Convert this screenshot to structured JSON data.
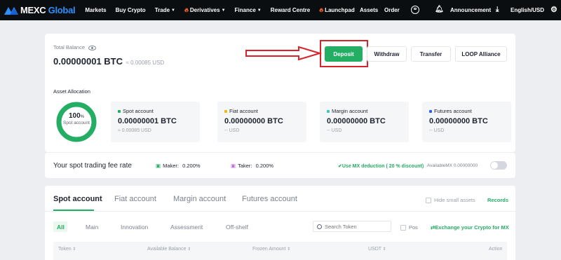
{
  "nav": {
    "logo_main": "MEXC",
    "logo_accent": "Global",
    "items": [
      {
        "label": "Markets",
        "chevron": false,
        "flame": false
      },
      {
        "label": "Buy Crypto",
        "chevron": false,
        "flame": false
      },
      {
        "label": "Trade",
        "chevron": true,
        "flame": false
      },
      {
        "label": "Derivatives",
        "chevron": true,
        "flame": true
      },
      {
        "label": "Finance",
        "chevron": true,
        "flame": false
      },
      {
        "label": "Reward Centre",
        "chevron": false,
        "flame": false
      },
      {
        "label": "Launchpad",
        "chevron": false,
        "flame": true
      }
    ],
    "right": {
      "assets": "Assets",
      "order": "Order",
      "announcement": "Announcement",
      "language": "English/USD"
    }
  },
  "balance": {
    "label": "Total Balance",
    "btc": "0.00000001 BTC",
    "usd": "≈ 0.00085 USD"
  },
  "actions": {
    "deposit": "Deposit",
    "withdraw": "Withdraw",
    "transfer": "Transfer",
    "loop": "LOOP Alliance"
  },
  "allocation": {
    "label": "Asset Allocation",
    "percent": "100",
    "percent_sign": "%",
    "ring_label": "Spot account",
    "ring_fill": 1.0,
    "accounts": [
      {
        "name": "Spot account",
        "amount": "0.00000001 BTC",
        "usd": "≈ 0.00085 USD",
        "color": "#24ae64"
      },
      {
        "name": "Fiat account",
        "amount": "0.00000000 BTC",
        "usd": "-- USD",
        "color": "#f0b90b"
      },
      {
        "name": "Margin account",
        "amount": "0.00000000 BTC",
        "usd": "-- USD",
        "color": "#3ec5c0"
      },
      {
        "name": "Futures account",
        "amount": "0.00000000 BTC",
        "usd": "-- USD",
        "color": "#2e5bff"
      }
    ]
  },
  "fees": {
    "title": "Your spot trading fee rate",
    "maker_label": "Maker:",
    "maker_value": "0.200%",
    "taker_label": "Taker:",
    "taker_value": "0.200%",
    "mx_deduction": "Use MX deduction ( 20 % discount)",
    "available": "AvailableMX 0.00000000"
  },
  "tabs": [
    "Spot account",
    "Fiat account",
    "Margin account",
    "Futures account"
  ],
  "hide_small": "Hide small assets",
  "records": "Records",
  "subtabs": [
    "All",
    "Main",
    "Innovation",
    "Assessment",
    "Off-shelf"
  ],
  "search": {
    "placeholder": "Search Token"
  },
  "pos": "Pos",
  "exchange": "Exchange your Crypto for MX",
  "table_headers": [
    "Token",
    "Available Balance",
    "Frozen Amount",
    "USDT",
    "Action"
  ]
}
